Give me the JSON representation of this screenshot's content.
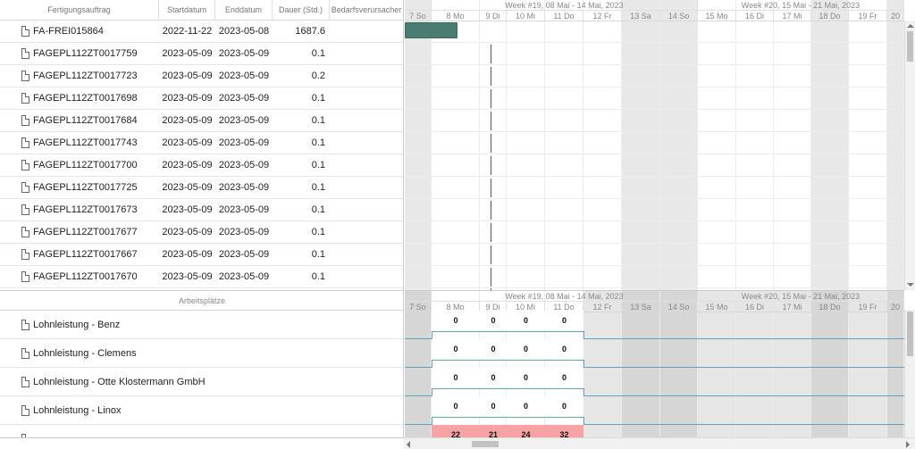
{
  "columns": [
    {
      "key": "order",
      "label": "Fertigungsauftrag"
    },
    {
      "key": "start",
      "label": "Startdatum"
    },
    {
      "key": "end",
      "label": "Enddatum"
    },
    {
      "key": "duration",
      "label": "Dauer (Std.)"
    },
    {
      "key": "cause",
      "label": "Bedarfsverursacher"
    }
  ],
  "tasks": [
    {
      "order": "FA-FREI015864",
      "start": "2022-11-22",
      "end": "2023-05-08",
      "duration": "1687.6",
      "cause": ""
    },
    {
      "order": "FAGEPL112ZT0017759",
      "start": "2023-05-09",
      "end": "2023-05-09",
      "duration": "0.1",
      "cause": ""
    },
    {
      "order": "FAGEPL112ZT0017723",
      "start": "2023-05-09",
      "end": "2023-05-09",
      "duration": "0.2",
      "cause": ""
    },
    {
      "order": "FAGEPL112ZT0017698",
      "start": "2023-05-09",
      "end": "2023-05-09",
      "duration": "0.1",
      "cause": ""
    },
    {
      "order": "FAGEPL112ZT0017684",
      "start": "2023-05-09",
      "end": "2023-05-09",
      "duration": "0.1",
      "cause": ""
    },
    {
      "order": "FAGEPL112ZT0017743",
      "start": "2023-05-09",
      "end": "2023-05-09",
      "duration": "0.1",
      "cause": ""
    },
    {
      "order": "FAGEPL112ZT0017700",
      "start": "2023-05-09",
      "end": "2023-05-09",
      "duration": "0.1",
      "cause": ""
    },
    {
      "order": "FAGEPL112ZT0017725",
      "start": "2023-05-09",
      "end": "2023-05-09",
      "duration": "0.1",
      "cause": ""
    },
    {
      "order": "FAGEPL112ZT0017673",
      "start": "2023-05-09",
      "end": "2023-05-09",
      "duration": "0.1",
      "cause": ""
    },
    {
      "order": "FAGEPL112ZT0017677",
      "start": "2023-05-09",
      "end": "2023-05-09",
      "duration": "0.1",
      "cause": ""
    },
    {
      "order": "FAGEPL112ZT0017667",
      "start": "2023-05-09",
      "end": "2023-05-09",
      "duration": "0.1",
      "cause": ""
    },
    {
      "order": "FAGEPL112ZT0017670",
      "start": "2023-05-09",
      "end": "2023-05-09",
      "duration": "0.1",
      "cause": ""
    }
  ],
  "timeline": {
    "weeks": [
      "Week #19, 08 Mai - 14 Mai, 2023",
      "Week #20, 15 Mai - 21 Mai, 2023"
    ],
    "days": [
      {
        "label": "7 So",
        "weekend": true
      },
      {
        "label": "8 Mo",
        "weekend": false
      },
      {
        "label": "9 Di",
        "weekend": false
      },
      {
        "label": "10 Mi",
        "weekend": false
      },
      {
        "label": "11 Do",
        "weekend": false
      },
      {
        "label": "12 Fr",
        "weekend": false
      },
      {
        "label": "13 Sa",
        "weekend": true
      },
      {
        "label": "14 So",
        "weekend": true
      },
      {
        "label": "15 Mo",
        "weekend": false
      },
      {
        "label": "16 Di",
        "weekend": false
      },
      {
        "label": "17 Mi",
        "weekend": false
      },
      {
        "label": "18 Do",
        "weekend": true
      },
      {
        "label": "19 Fr",
        "weekend": false
      },
      {
        "label": "20",
        "weekend": true
      }
    ]
  },
  "resources": {
    "header": "Arbeitsplätze",
    "items": [
      {
        "name": "Lohnleistung - Benz",
        "loads": [
          "0",
          "0",
          "0",
          "0"
        ],
        "high": false
      },
      {
        "name": "Lohnleistung - Clemens",
        "loads": [
          "0",
          "0",
          "0",
          "0"
        ],
        "high": false
      },
      {
        "name": "Lohnleistung - Otte Klostermann GmbH",
        "loads": [
          "0",
          "0",
          "0",
          "0"
        ],
        "high": false
      },
      {
        "name": "Lohnleistung - Linox",
        "loads": [
          "0",
          "0",
          "0",
          "0"
        ],
        "high": false
      },
      {
        "name": "",
        "loads": [
          "22",
          "21",
          "24",
          "32"
        ],
        "high": true
      }
    ]
  },
  "colors": {
    "taskBar": "#4a7d72",
    "overload": "#f7a3a3",
    "capacity": "#5aa9b8"
  }
}
